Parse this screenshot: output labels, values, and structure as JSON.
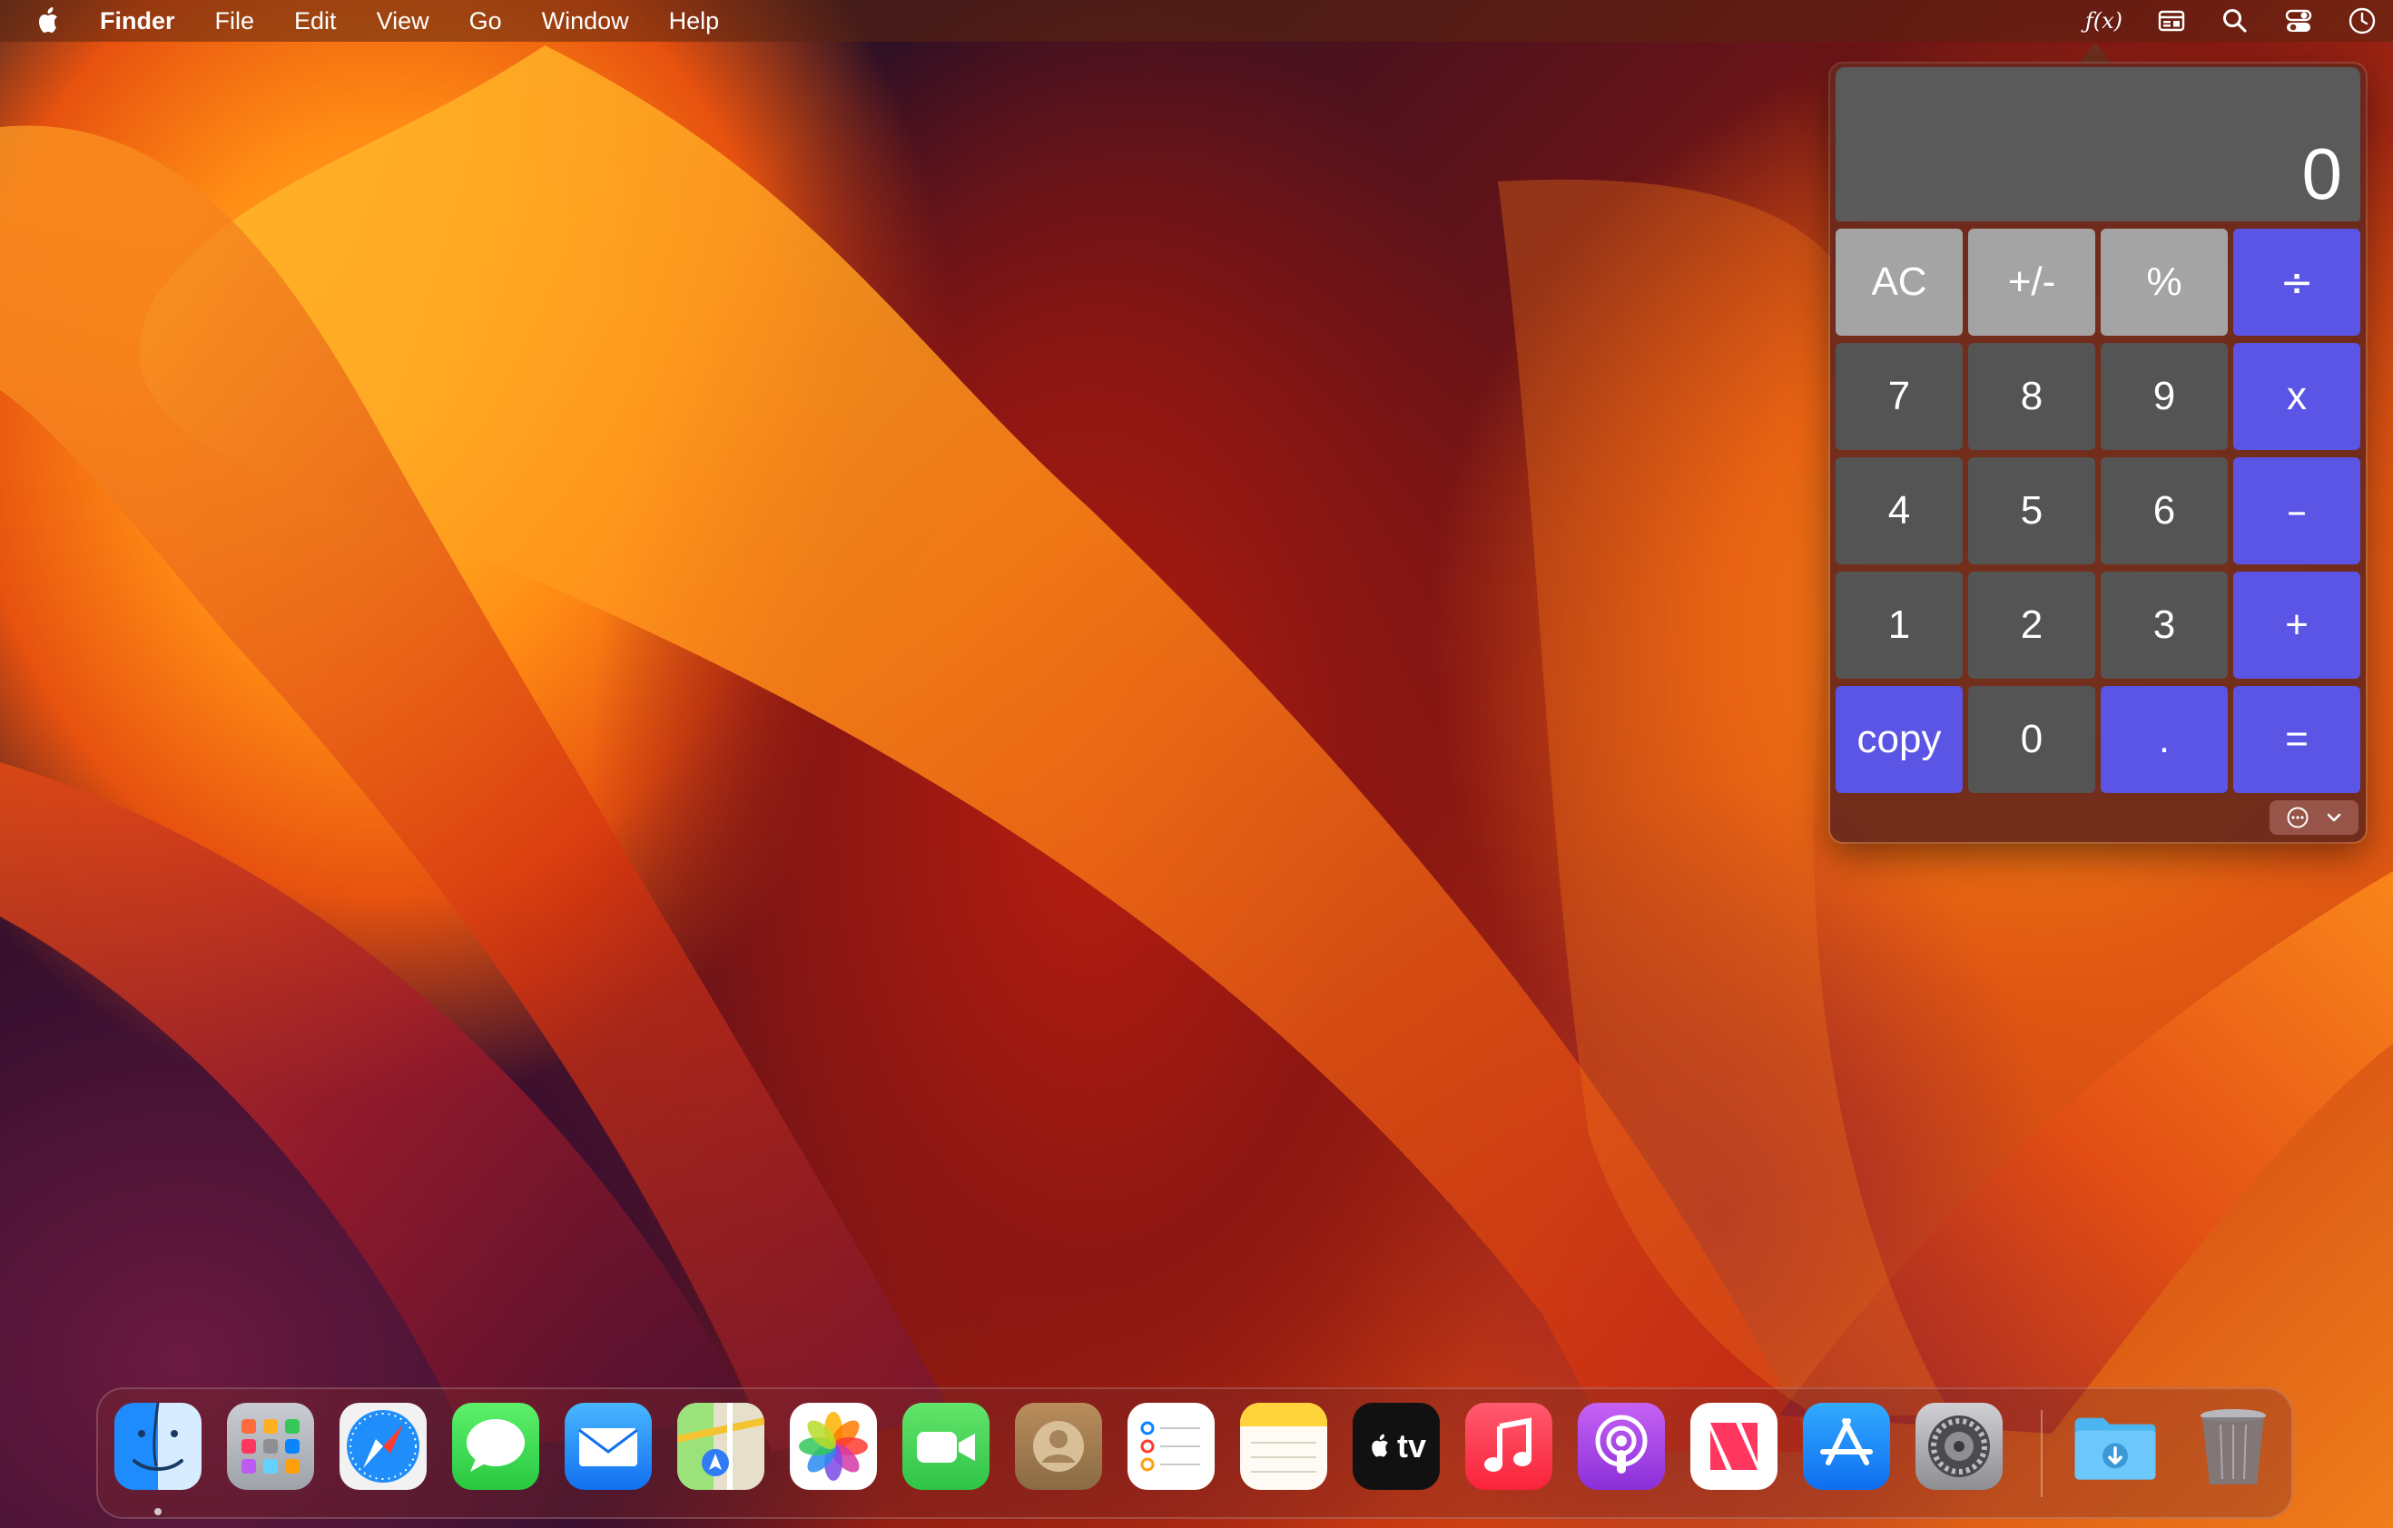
{
  "menubar": {
    "apple_icon": "apple-icon",
    "app_name": "Finder",
    "items": [
      "File",
      "Edit",
      "View",
      "Go",
      "Window",
      "Help"
    ],
    "status": {
      "fx_label": "ƒ(x)",
      "icons": [
        "formula-display-icon",
        "search-icon",
        "control-center-icon",
        "clock-icon"
      ]
    }
  },
  "calculator": {
    "display_value": "0",
    "keys": {
      "ac": "AC",
      "plus_minus": "+/-",
      "percent": "%",
      "divide": "÷",
      "seven": "7",
      "eight": "8",
      "nine": "9",
      "multiply": "x",
      "four": "4",
      "five": "5",
      "six": "6",
      "minus": "–",
      "one": "1",
      "two": "2",
      "three": "3",
      "plus": "+",
      "copy": "copy",
      "zero": "0",
      "decimal": ".",
      "equals": "="
    },
    "footer_icons": [
      "more-options-icon",
      "chevron-down-icon"
    ],
    "colors": {
      "function_key": "#a4a4a4",
      "number_key": "#545454",
      "operator_key": "#5b55e6",
      "display": "#5a5a5a"
    }
  },
  "dock": {
    "apps": [
      "Finder",
      "Launchpad",
      "Safari",
      "Messages",
      "Mail",
      "Maps",
      "Photos",
      "FaceTime",
      "Contacts",
      "Reminders",
      "Notes",
      "TV",
      "Music",
      "Podcasts",
      "News",
      "App Store",
      "System Settings"
    ],
    "tv_label": "tv",
    "others": [
      "Downloads",
      "Trash"
    ]
  }
}
